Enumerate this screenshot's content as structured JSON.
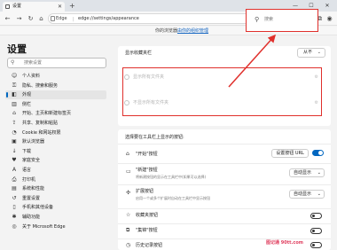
{
  "browser": {
    "tab_title": "设置",
    "omnibox_prefix": "Edge",
    "url": "edge://settings/appearance"
  },
  "promo": {
    "text": "你的浏览器",
    "link": "由你的组织管理"
  },
  "sidebar": {
    "title": "设置",
    "search_placeholder": "搜索设置",
    "items": [
      {
        "label": "个人资料",
        "icon": "person-icon",
        "active": false
      },
      {
        "label": "隐私、搜索和服务",
        "icon": "lock-icon",
        "active": false
      },
      {
        "label": "外观",
        "icon": "appearance-icon",
        "active": true
      },
      {
        "label": "侧栏",
        "icon": "sidebar-icon",
        "active": false
      },
      {
        "label": "开始、主页和新建标签页",
        "icon": "home-icon",
        "active": false
      },
      {
        "label": "共享、复制和粘贴",
        "icon": "share-icon",
        "active": false
      },
      {
        "label": "Cookie 和网站权限",
        "icon": "cookie-icon",
        "active": false
      },
      {
        "label": "默认浏览器",
        "icon": "browser-icon",
        "active": false
      },
      {
        "label": "下载",
        "icon": "download-icon",
        "active": false
      },
      {
        "label": "家庭安全",
        "icon": "family-icon",
        "active": false
      },
      {
        "label": "语言",
        "icon": "language-icon",
        "active": false
      },
      {
        "label": "打印机",
        "icon": "printer-icon",
        "active": false
      },
      {
        "label": "系统和性能",
        "icon": "system-icon",
        "active": false
      },
      {
        "label": "重置设置",
        "icon": "reset-icon",
        "active": false
      },
      {
        "label": "手机和其他设备",
        "icon": "phone-icon",
        "active": false
      },
      {
        "label": "辅助功能",
        "icon": "accessibility-icon",
        "active": false
      },
      {
        "label": "关于 Microsoft Edge",
        "icon": "edge-icon",
        "active": false
      }
    ]
  },
  "favorites_bar": {
    "title": "显示收藏夹栏",
    "dropdown_value": "从不",
    "options": [
      {
        "label": "显示所有文件夹"
      },
      {
        "label": "不显示所有文件夹"
      }
    ]
  },
  "toolbar_section": {
    "title": "选择要在工具栏上显示的按钮:",
    "rows": [
      {
        "icon": "home-icon",
        "label": "\"开始\"按钮",
        "sub": "",
        "control": "url-button+toggle-on",
        "button_label": "设置按钮 URL"
      },
      {
        "icon": "tabs-icon",
        "label": "\"新建\"按钮",
        "sub": "将新建按钮的显示在工具栏中(如果可以选择)",
        "control": "dropdown",
        "dropdown_value": "自动显示"
      },
      {
        "icon": "extension-icon",
        "label": "扩展按钮",
        "sub": "启用一个或多个扩展时自动在工具栏中显示按钮",
        "control": "dropdown",
        "dropdown_value": "自动显示"
      },
      {
        "icon": "star-icon",
        "label": "收藏夹按钮",
        "sub": "",
        "control": "toggle-off"
      },
      {
        "icon": "collections-icon",
        "label": "\"集锦\"按钮",
        "sub": "",
        "control": "toggle-off"
      },
      {
        "icon": "history-icon",
        "label": "历史记录按钮",
        "sub": "",
        "control": "toggle-off"
      }
    ]
  },
  "search_box": {
    "placeholder": "搜索"
  },
  "watermark": "图记通 90tt.com",
  "colors": {
    "accent": "#0067c0",
    "annotation": "#e0302c"
  }
}
